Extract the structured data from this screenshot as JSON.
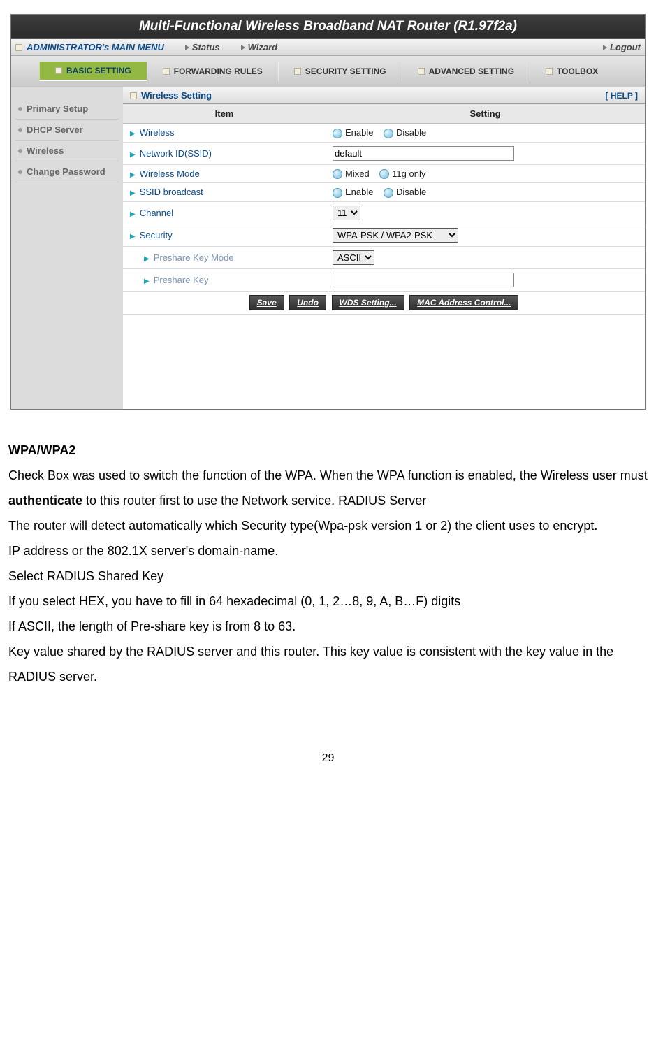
{
  "router": {
    "title": "Multi-Functional Wireless Broadband NAT Router (R1.97f2a)",
    "menu": {
      "label": "ADMINISTRATOR's MAIN MENU",
      "status": "Status",
      "wizard": "Wizard",
      "logout": "Logout"
    },
    "tabs": {
      "basic": "BASIC SETTING",
      "forwarding": "FORWARDING RULES",
      "security": "SECURITY SETTING",
      "advanced": "ADVANCED SETTING",
      "toolbox": "TOOLBOX"
    },
    "sidebar": {
      "primary": "Primary Setup",
      "dhcp": "DHCP Server",
      "wireless": "Wireless",
      "changepw": "Change Password"
    },
    "panel": {
      "title": "Wireless Setting",
      "help": "[ HELP ]",
      "th_item": "Item",
      "th_setting": "Setting"
    },
    "rows": {
      "wireless": "Wireless",
      "wireless_enable": "Enable",
      "wireless_disable": "Disable",
      "ssid_label": "Network ID(SSID)",
      "ssid_value": "default",
      "mode_label": "Wireless Mode",
      "mode_mixed": "Mixed",
      "mode_11g": "11g only",
      "ssidb_label": "SSID broadcast",
      "ssidb_enable": "Enable",
      "ssidb_disable": "Disable",
      "channel_label": "Channel",
      "channel_value": "11",
      "security_label": "Security",
      "security_value": "WPA-PSK / WPA2-PSK",
      "pkmode_label": "Preshare Key Mode",
      "pkmode_value": "ASCII",
      "pk_label": "Preshare Key"
    },
    "buttons": {
      "save": "Save",
      "undo": "Undo",
      "wds": "WDS Setting...",
      "mac": "MAC Address Control..."
    }
  },
  "doc": {
    "h1": "WPA/WPA2",
    "p1a": "Check Box was used to switch the function of the WPA. When the WPA function is enabled, the Wireless user must ",
    "p1b": "authenticate",
    "p1c": " to this router first to use the Network service. RADIUS Server",
    "p2": "The router will detect automatically   which Security type(Wpa-psk version 1 or 2) the client uses to encrypt.",
    "p3": "IP address or the 802.1X server's domain-name.",
    "p4": "Select RADIUS Shared Key",
    "p5": "If you select HEX, you have to fill in 64 hexadecimal (0, 1, 2…8, 9, A, B…F) digits",
    "p6": "If ASCII, the length of Pre-share key is from 8 to 63.",
    "p7": "Key value shared by the RADIUS server and this router. This key value is consistent with the key value in the RADIUS server."
  },
  "page_number": "29"
}
